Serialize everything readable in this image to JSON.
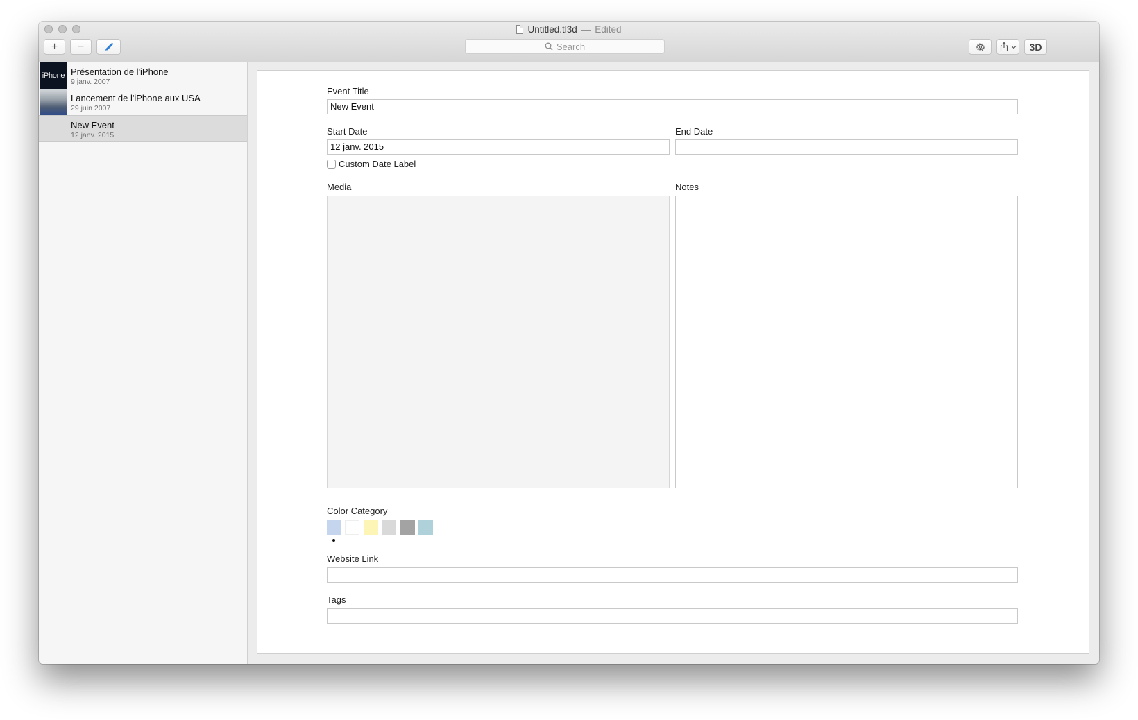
{
  "window": {
    "title": "Untitled.tl3d",
    "edited_separator": "—",
    "edited_label": "Edited"
  },
  "toolbar": {
    "add_glyph": "+",
    "remove_glyph": "−",
    "search_placeholder": "Search",
    "three_d_label": "3D"
  },
  "sidebar": {
    "items": [
      {
        "title": "Présentation de l'iPhone",
        "date": "9 janv. 2007",
        "thumb_text": "iPhone",
        "selected": false
      },
      {
        "title": "Lancement de l'iPhone aux USA",
        "date": "29 juin 2007",
        "selected": false
      },
      {
        "title": "New Event",
        "date": "12 janv. 2015",
        "selected": true
      }
    ]
  },
  "form": {
    "event_title_label": "Event Title",
    "event_title_value": "New Event",
    "start_date_label": "Start Date",
    "start_date_value": "12 janv. 2015",
    "end_date_label": "End Date",
    "end_date_value": "",
    "custom_date_label": "Custom Date Label",
    "custom_date_checked": false,
    "media_label": "Media",
    "notes_label": "Notes",
    "notes_value": "",
    "color_category_label": "Color Category",
    "color_swatches": [
      "#c5d5ee",
      "#ffffff",
      "#fdf5b5",
      "#d9d9d9",
      "#a3a3a3",
      "#aed1da"
    ],
    "selected_color_index": 0,
    "website_link_label": "Website Link",
    "website_link_value": "",
    "tags_label": "Tags",
    "tags_value": ""
  }
}
